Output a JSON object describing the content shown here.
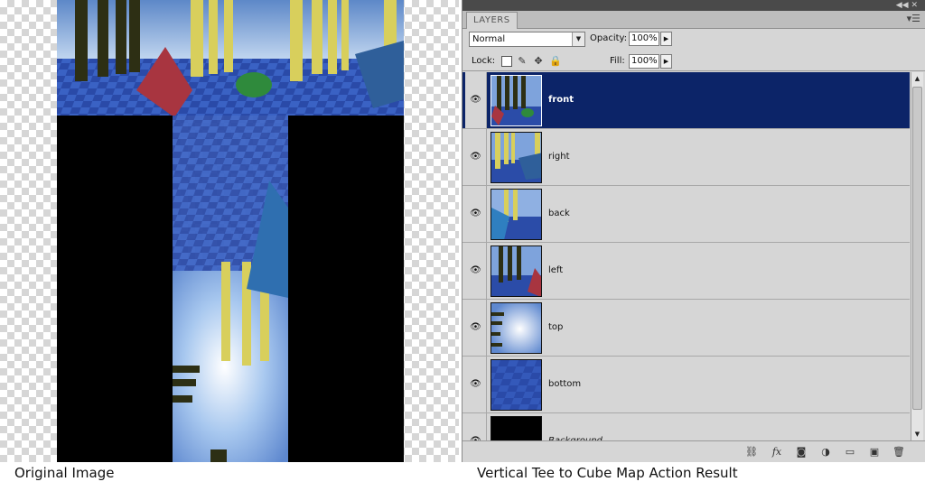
{
  "captions": {
    "left": "Original Image",
    "right": "Vertical Tee to Cube Map Action Result"
  },
  "panel": {
    "tab_label": "LAYERS",
    "blend_mode": "Normal",
    "opacity_label": "Opacity:",
    "opacity_value": "100%",
    "lock_label": "Lock:",
    "fill_label": "Fill:",
    "fill_value": "100%",
    "layers": [
      {
        "name": "front",
        "selected": true
      },
      {
        "name": "right",
        "selected": false
      },
      {
        "name": "back",
        "selected": false
      },
      {
        "name": "left",
        "selected": false
      },
      {
        "name": "top",
        "selected": false
      },
      {
        "name": "bottom",
        "selected": false
      },
      {
        "name": "Background",
        "selected": false
      }
    ],
    "icons": {
      "eye": "eye-icon",
      "link": "link-layers-icon",
      "fx": "fx-icon",
      "mask": "layer-mask-icon",
      "adjust": "adjustment-layer-icon",
      "group": "new-group-icon",
      "new": "new-layer-icon",
      "trash": "delete-layer-icon"
    }
  }
}
